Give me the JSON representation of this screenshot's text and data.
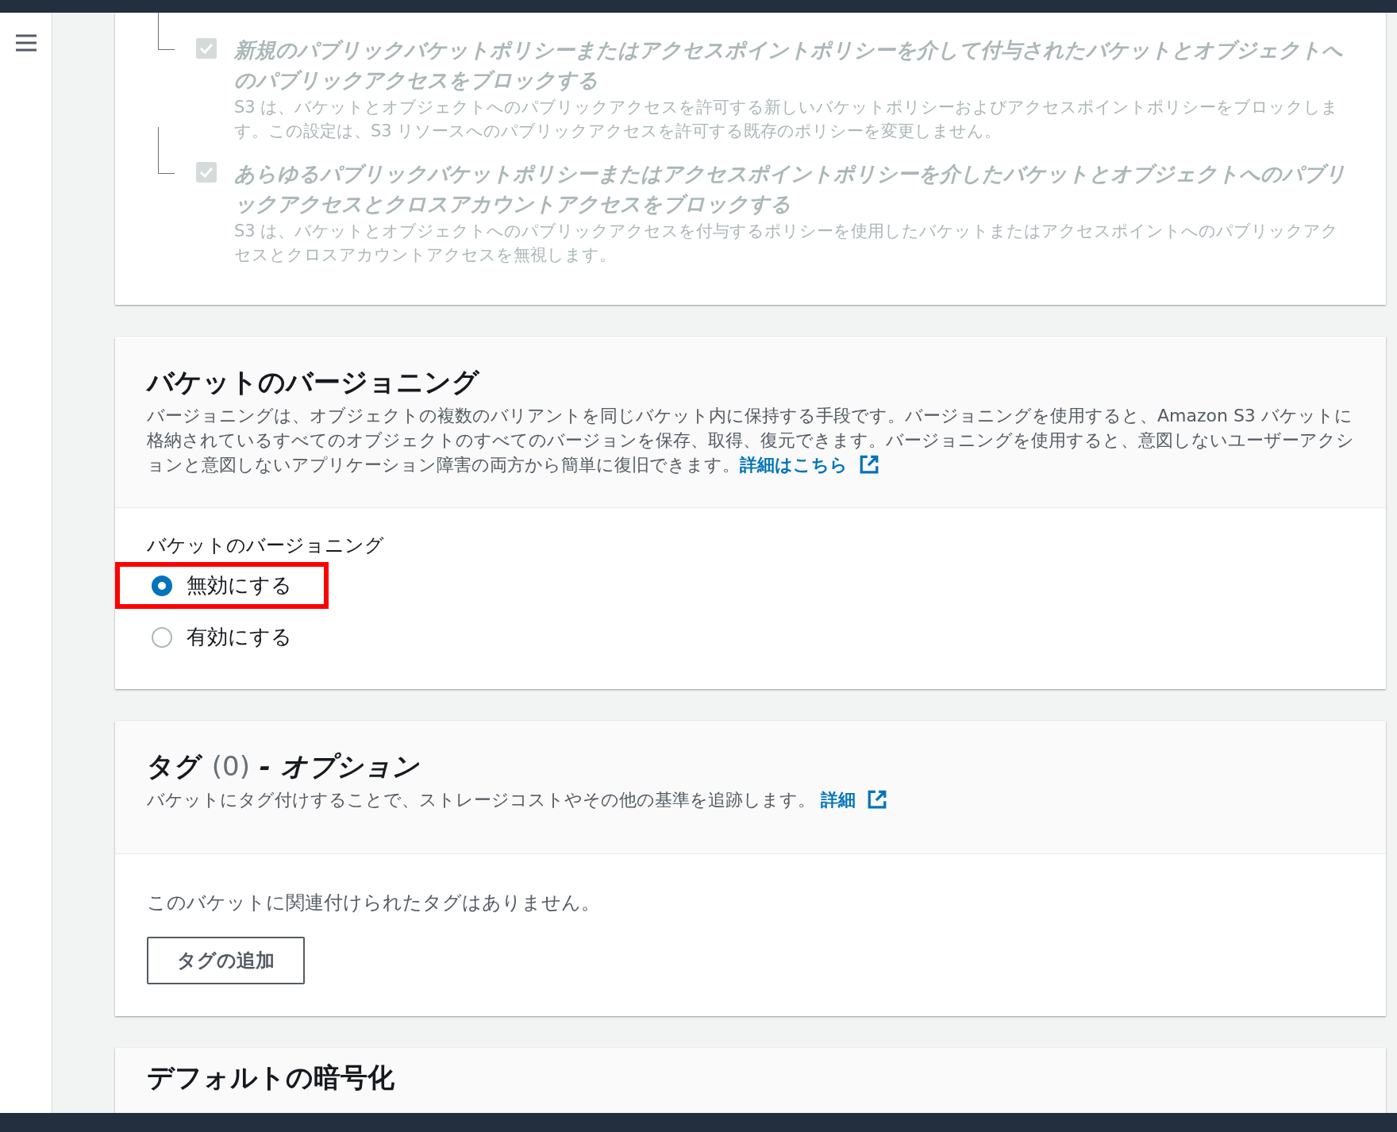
{
  "block_public_access": {
    "options": [
      {
        "title": "新規のパブリックバケットポリシーまたはアクセスポイントポリシーを介して付与されたバケットとオブジェクトへのパブリックアクセスをブロックする",
        "description": "S3 は、バケットとオブジェクトへのパブリックアクセスを許可する新しいバケットポリシーおよびアクセスポイントポリシーをブロックします。この設定は、S3 リソースへのパブリックアクセスを許可する既存のポリシーを変更しません。",
        "checked": true,
        "disabled": true
      },
      {
        "title": "あらゆるパブリックバケットポリシーまたはアクセスポイントポリシーを介したバケットとオブジェクトへのパブリックアクセスとクロスアカウントアクセスをブロックする",
        "description": "S3 は、バケットとオブジェクトへのパブリックアクセスを付与するポリシーを使用したバケットまたはアクセスポイントへのパブリックアクセスとクロスアカウントアクセスを無視します。",
        "checked": true,
        "disabled": true
      }
    ]
  },
  "versioning": {
    "title": "バケットのバージョニング",
    "description": "バージョニングは、オブジェクトの複数のバリアントを同じバケット内に保持する手段です。バージョニングを使用すると、Amazon S3 バケットに格納されているすべてのオブジェクトのすべてのバージョンを保存、取得、復元できます。バージョニングを使用すると、意図しないユーザーアクションと意図しないアプリケーション障害の両方から簡単に復旧できます。",
    "link": "詳細はこちら",
    "field_label": "バケットのバージョニング",
    "options": [
      {
        "label": "無効にする",
        "selected": true,
        "highlighted": true
      },
      {
        "label": "有効にする",
        "selected": false,
        "highlighted": false
      }
    ]
  },
  "tags": {
    "title": "タグ",
    "count": "(0)",
    "subtitle": "- オプション",
    "description": "バケットにタグ付けすることで、ストレージコストやその他の基準を追跡します。",
    "link": "詳細",
    "empty_text": "このバケットに関連付けられたタグはありません。",
    "add_button": "タグの追加"
  },
  "encryption": {
    "title": "デフォルトの暗号化"
  }
}
